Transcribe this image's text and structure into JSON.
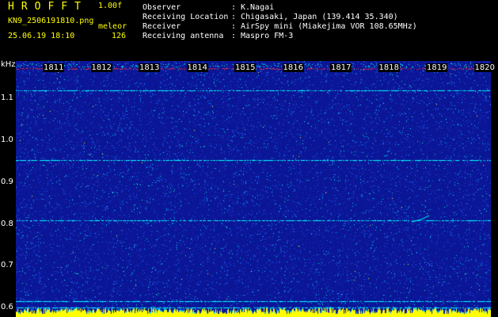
{
  "app": {
    "title": "HROFFT",
    "version": "1.00f",
    "filename": "KN9_2506191810.png",
    "mode": "meleor",
    "datetime": "25.06.19 18:10",
    "count": "126"
  },
  "meta": [
    {
      "label": "Observer",
      "value": "K.Nagai"
    },
    {
      "label": "Receiving Location",
      "value": "Chigasaki, Japan (139.414 35.340)"
    },
    {
      "label": "Receiver",
      "value": "AirSpy mini (Miakejima VOR 108.65MHz)"
    },
    {
      "label": "Receiving antenna",
      "value": "Maspro FM-3"
    }
  ],
  "colon": ":",
  "waterfall": {
    "freq_unit": "kHz",
    "freq_labels": [
      "1.1",
      "1.0",
      "0.9",
      "0.8",
      "0.7",
      "0.6"
    ],
    "time_labels": [
      "1811",
      "1812",
      "1813",
      "1814",
      "1815",
      "1816",
      "1817",
      "1818",
      "1819",
      "1820"
    ],
    "freq_range_khz": [
      0.58,
      1.19
    ],
    "tone_lines_khz": [
      1.12,
      0.953,
      0.81,
      0.617,
      0.603
    ],
    "colors": {
      "background": "#0a1696",
      "noise": [
        "#1e32c8",
        "#1e64ff",
        "#00c8ff",
        "#00ffcc",
        "#ffff00"
      ],
      "tone": "#00ffff",
      "top_band": "#ff3030",
      "bottom_band": "#ffff00"
    }
  }
}
